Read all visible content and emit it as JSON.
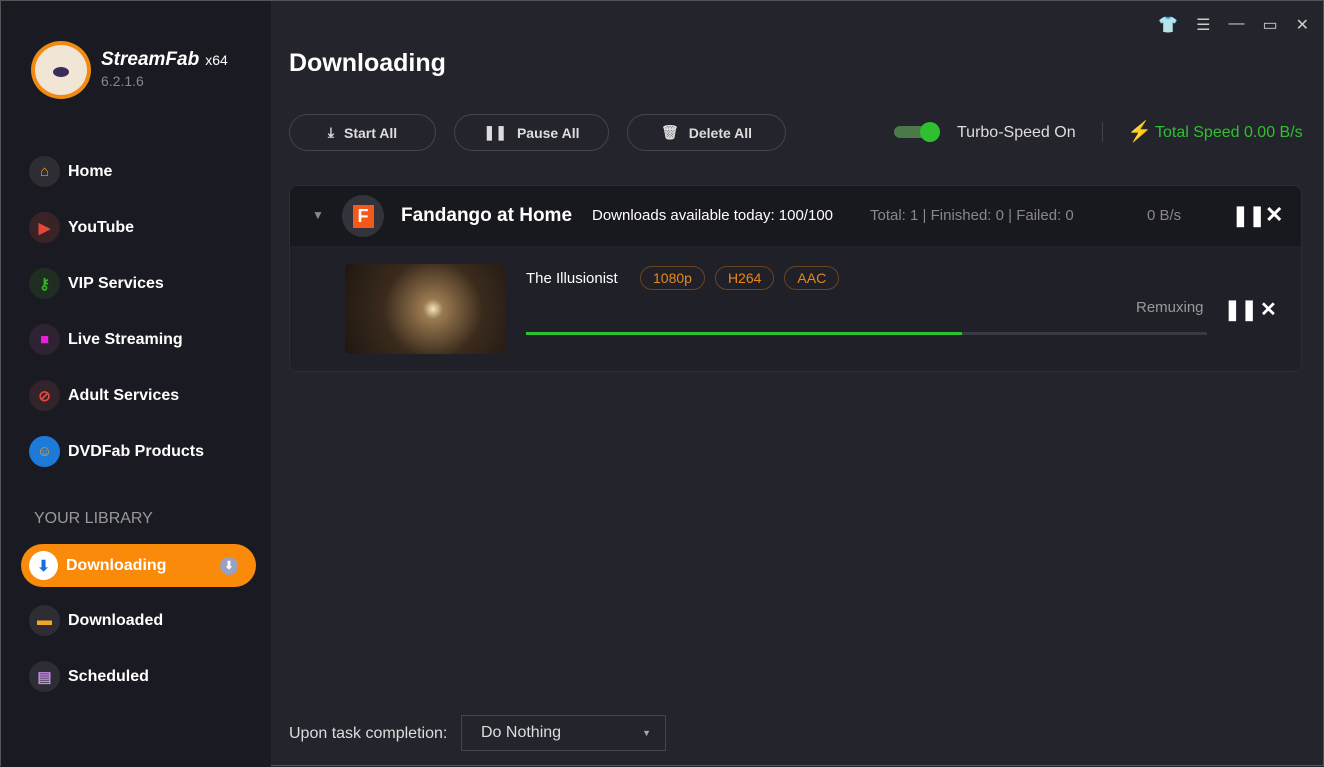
{
  "app": {
    "name": "StreamFab",
    "arch": "x64",
    "version": "6.2.1.6"
  },
  "sidebar": {
    "items": [
      {
        "label": "Home",
        "icon": "home-icon",
        "color": "#f39a1e",
        "bg": "#2d2d33"
      },
      {
        "label": "YouTube",
        "icon": "youtube-icon",
        "color": "#e5473a",
        "bg": "#3a2327"
      },
      {
        "label": "VIP Services",
        "icon": "key-icon",
        "color": "#35b52a",
        "bg": "#1f2d22"
      },
      {
        "label": "Live Streaming",
        "icon": "camera-icon",
        "color": "#e71fd7",
        "bg": "#2d2333"
      },
      {
        "label": "Adult Services",
        "icon": "no-18-icon",
        "color": "#e5473a",
        "bg": "#33232a"
      },
      {
        "label": "DVDFab Products",
        "icon": "dvdfab-icon",
        "color": "#f39a1e",
        "bg": "#1e7ad8"
      }
    ],
    "library_label": "YOUR LIBRARY",
    "library": [
      {
        "label": "Downloading"
      },
      {
        "label": "Downloaded",
        "icon": "folder-icon"
      },
      {
        "label": "Scheduled",
        "icon": "clipboard-icon"
      }
    ]
  },
  "main": {
    "title": "Downloading",
    "start_all": "Start All",
    "pause_all": "Pause All",
    "delete_all": "Delete All",
    "turbo": "Turbo-Speed On",
    "total_speed": "Total Speed 0.00 B/s"
  },
  "group": {
    "name": "Fandango at Home",
    "avail": "Downloads available today: 100/100",
    "total": "Total: 1",
    "finished": "Finished: 0",
    "failed": "Failed: 0",
    "speed": "0 B/s"
  },
  "task": {
    "title": "The Illusionist",
    "tags": [
      "1080p",
      "H264",
      "AAC"
    ],
    "status": "Remuxing",
    "progress_percent": 64
  },
  "footer": {
    "label": "Upon task completion:",
    "selected": "Do Nothing"
  }
}
